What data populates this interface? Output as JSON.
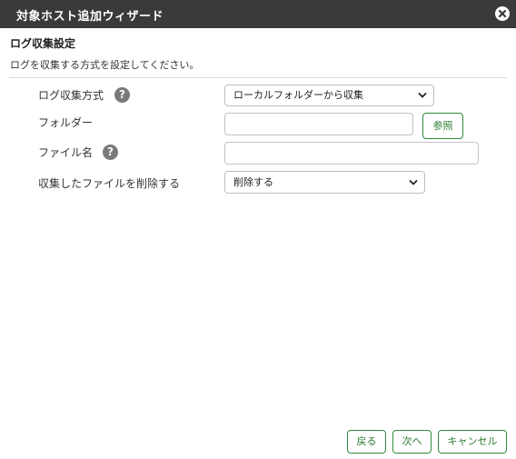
{
  "window": {
    "title": "対象ホスト追加ウィザード",
    "close_icon": "close-icon"
  },
  "section": {
    "title": "ログ収集設定",
    "description": "ログを収集する方式を設定してください。"
  },
  "form": {
    "method": {
      "label": "ログ収集方式",
      "selected": "ローカルフォルダーから収集"
    },
    "folder": {
      "label": "フォルダー",
      "value": "",
      "browse_label": "参照"
    },
    "filename": {
      "label": "ファイル名",
      "value": ""
    },
    "delete": {
      "label": "収集したファイルを削除する",
      "selected": "削除する"
    },
    "help_glyph": "?"
  },
  "footer": {
    "back_label": "戻る",
    "next_label": "次へ",
    "cancel_label": "キャンセル"
  },
  "colors": {
    "titlebar": "#3a3a3a",
    "accent": "#2e7d32"
  }
}
